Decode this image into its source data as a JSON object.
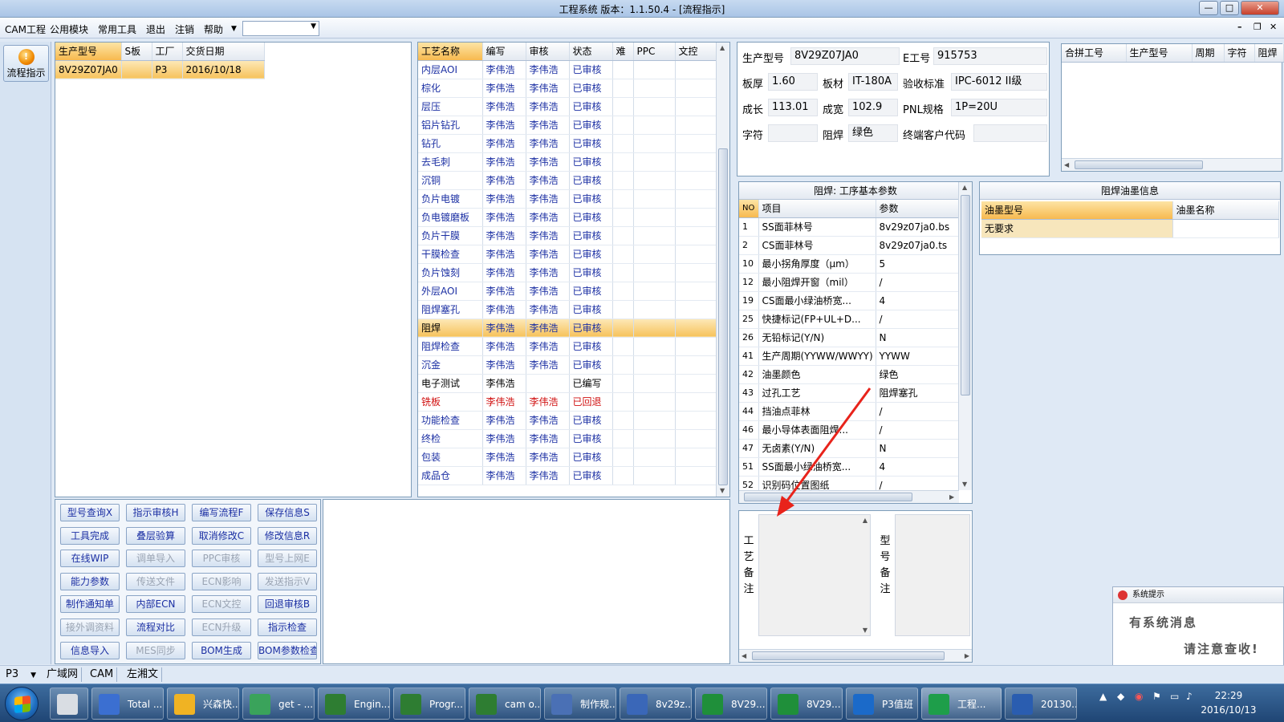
{
  "window": {
    "title": "工程系统  版本：1.1.50.4 - [流程指示]"
  },
  "menu": {
    "items": [
      "CAM工程",
      "公用模块",
      "常用工具",
      "退出",
      "注销",
      "帮助"
    ],
    "dropdown_value": ""
  },
  "left_toolbar": {
    "flow_label": "流程指示"
  },
  "orders": {
    "columns": [
      "生产型号",
      "S板",
      "工厂",
      "交货日期"
    ],
    "rows": [
      [
        "8V29Z07JA0",
        "",
        "P3",
        "2016/10/18"
      ]
    ]
  },
  "process": {
    "columns": [
      "工艺名称",
      "编写",
      "审核",
      "状态",
      "难",
      "PPC",
      "文控"
    ],
    "rows": [
      {
        "name": "内层AOI",
        "writer": "李伟浩",
        "reviewer": "李伟浩",
        "status": "已审核"
      },
      {
        "name": "棕化",
        "writer": "李伟浩",
        "reviewer": "李伟浩",
        "status": "已审核"
      },
      {
        "name": "层压",
        "writer": "李伟浩",
        "reviewer": "李伟浩",
        "status": "已审核"
      },
      {
        "name": "铝片钻孔",
        "writer": "李伟浩",
        "reviewer": "李伟浩",
        "status": "已审核"
      },
      {
        "name": "钻孔",
        "writer": "李伟浩",
        "reviewer": "李伟浩",
        "status": "已审核"
      },
      {
        "name": "去毛刺",
        "writer": "李伟浩",
        "reviewer": "李伟浩",
        "status": "已审核"
      },
      {
        "name": "沉铜",
        "writer": "李伟浩",
        "reviewer": "李伟浩",
        "status": "已审核"
      },
      {
        "name": "负片电镀",
        "writer": "李伟浩",
        "reviewer": "李伟浩",
        "status": "已审核"
      },
      {
        "name": "负电镀磨板",
        "writer": "李伟浩",
        "reviewer": "李伟浩",
        "status": "已审核"
      },
      {
        "name": "负片干膜",
        "writer": "李伟浩",
        "reviewer": "李伟浩",
        "status": "已审核"
      },
      {
        "name": "干膜检查",
        "writer": "李伟浩",
        "reviewer": "李伟浩",
        "status": "已审核"
      },
      {
        "name": "负片蚀刻",
        "writer": "李伟浩",
        "reviewer": "李伟浩",
        "status": "已审核"
      },
      {
        "name": "外层AOI",
        "writer": "李伟浩",
        "reviewer": "李伟浩",
        "status": "已审核"
      },
      {
        "name": "阻焊塞孔",
        "writer": "李伟浩",
        "reviewer": "李伟浩",
        "status": "已审核"
      },
      {
        "name": "阻焊",
        "writer": "李伟浩",
        "reviewer": "李伟浩",
        "status": "已审核",
        "selected": true
      },
      {
        "name": "阻焊检查",
        "writer": "李伟浩",
        "reviewer": "李伟浩",
        "status": "已审核"
      },
      {
        "name": "沉金",
        "writer": "李伟浩",
        "reviewer": "李伟浩",
        "status": "已审核"
      },
      {
        "name": "电子测试",
        "writer": "李伟浩",
        "reviewer": "",
        "status": "已编写",
        "tone": "black"
      },
      {
        "name": "铣板",
        "writer": "李伟浩",
        "reviewer": "李伟浩",
        "status": "已回退",
        "tone": "red"
      },
      {
        "name": "功能检查",
        "writer": "李伟浩",
        "reviewer": "李伟浩",
        "status": "已审核"
      },
      {
        "name": "终检",
        "writer": "李伟浩",
        "reviewer": "李伟浩",
        "status": "已审核"
      },
      {
        "name": "包装",
        "writer": "李伟浩",
        "reviewer": "李伟浩",
        "status": "已审核"
      },
      {
        "name": "成品仓",
        "writer": "李伟浩",
        "reviewer": "李伟浩",
        "status": "已审核"
      }
    ]
  },
  "buttons": [
    [
      "型号查询X",
      "指示审核H",
      "编写流程F",
      "保存信息S"
    ],
    [
      "工具完成",
      "叠层验算",
      "取消修改C",
      "修改信息R"
    ],
    [
      "在线WIP",
      "调单导入",
      "PPC审核",
      "型号上网E"
    ],
    [
      "能力参数",
      "传送文件",
      "ECN影响",
      "发送指示V"
    ],
    [
      "制作通知单",
      "内部ECN",
      "ECN文控",
      "回退审核B"
    ],
    [
      "接外调资料",
      "流程对比",
      "ECN升级",
      "指示检查"
    ],
    [
      "信息导入",
      "MES同步",
      "BOM生成",
      "BOM参数检查"
    ]
  ],
  "button_disabled": [
    [
      false,
      false,
      false,
      false
    ],
    [
      false,
      false,
      false,
      false
    ],
    [
      false,
      true,
      true,
      true
    ],
    [
      false,
      true,
      true,
      true
    ],
    [
      false,
      false,
      true,
      false
    ],
    [
      true,
      false,
      true,
      false
    ],
    [
      false,
      true,
      false,
      false
    ]
  ],
  "info": {
    "model_label": "生产型号",
    "model_value": "8V29Z07JA0",
    "ejob_label": "E工号",
    "ejob_value": "915753",
    "thickness_label": "板厚",
    "thickness_value": "1.60",
    "material_label": "板材",
    "material_value": "IT-180A",
    "standard_label": "验收标准",
    "standard_value": "IPC-6012 II级",
    "length_label": "成长",
    "length_value": "113.01",
    "width_label": "成宽",
    "width_value": "102.9",
    "pnl_label": "PNL规格",
    "pnl_value": "1P=20U",
    "char_label": "字符",
    "char_value": "",
    "mask_label": "阻焊",
    "mask_value": "绿色",
    "customer_label": "终端客户代码",
    "customer_value": ""
  },
  "merge": {
    "columns": [
      "合拼工号",
      "生产型号",
      "周期",
      "字符",
      "阻焊"
    ]
  },
  "params": {
    "title": "阻焊: 工序基本参数",
    "columns": [
      "NO",
      "项目",
      "参数"
    ],
    "rows": [
      [
        "1",
        "SS面菲林号",
        "8v29z07ja0.bs"
      ],
      [
        "2",
        "CS面菲林号",
        "8v29z07ja0.ts"
      ],
      [
        "10",
        "最小拐角厚度（μm）",
        "5"
      ],
      [
        "12",
        "最小阻焊开窗（mil）",
        "/"
      ],
      [
        "19",
        "CS面最小绿油桥宽...",
        "4"
      ],
      [
        "25",
        "快捷标记(FP+UL+D...",
        "/"
      ],
      [
        "26",
        "无铅标记(Y/N)",
        "N"
      ],
      [
        "41",
        "生产周期(YYWW/WWYY)",
        "YYWW"
      ],
      [
        "42",
        "油墨颜色",
        "绿色"
      ],
      [
        "43",
        "过孔工艺",
        "阻焊塞孔"
      ],
      [
        "44",
        "挡油点菲林",
        "/"
      ],
      [
        "46",
        "最小导体表面阻焊...",
        "/"
      ],
      [
        "47",
        "无卤素(Y/N)",
        "N"
      ],
      [
        "51",
        "SS面最小绿油桥宽...",
        "4"
      ],
      [
        "52",
        "识别码位置图纸",
        "/"
      ]
    ]
  },
  "ink": {
    "title": "阻焊油墨信息",
    "columns": [
      "油墨型号",
      "油墨名称"
    ],
    "rows": [
      [
        "无要求",
        ""
      ]
    ]
  },
  "remarks": {
    "process_label": "工艺备注",
    "model_label": "型号备注"
  },
  "popup": {
    "title": "系统提示",
    "line1": "有系统消息",
    "line2": "请注意查收!"
  },
  "statusbar": {
    "factory": "P3",
    "tabs": [
      "广域网",
      "CAM",
      "左湘文"
    ]
  },
  "taskbar": {
    "items": [
      "",
      "Total ...",
      "兴森快...",
      "get - ...",
      "Engin...",
      "Progr...",
      "cam o...",
      "制作规...",
      "8v29z...",
      "8V29...",
      "8V29...",
      "P3值班",
      "工程...",
      "20130..."
    ],
    "time": "22:29",
    "date": "2016/10/13"
  },
  "colors": {
    "accent_row": "#f6c25c",
    "review_text": "#1b2fa3",
    "rollback_text": "#d01010",
    "annotation_arrow": "#e8231b"
  }
}
